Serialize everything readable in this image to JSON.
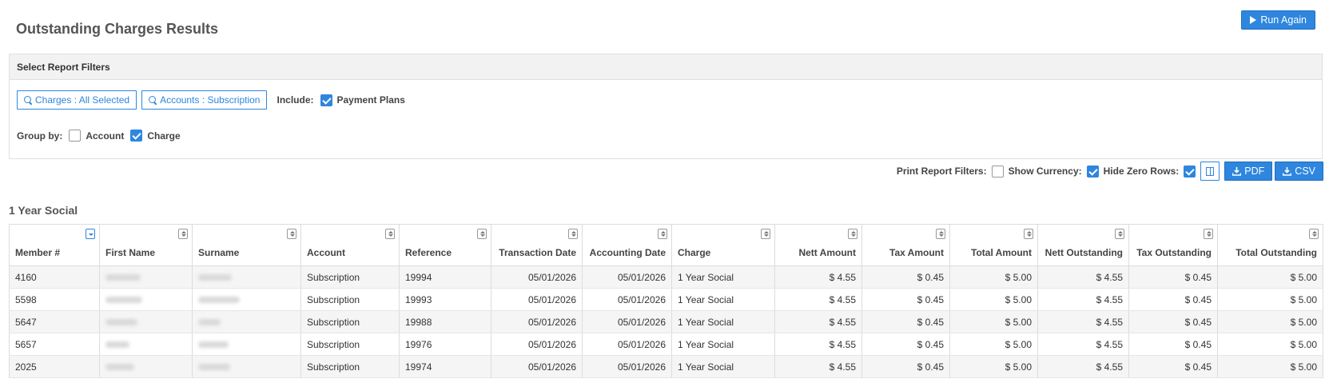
{
  "page": {
    "title": "Outstanding Charges Results",
    "run_again_label": "Run Again"
  },
  "filters": {
    "header": "Select Report Filters",
    "charges_button": "Charges : All Selected",
    "accounts_button": "Accounts : Subscription",
    "include_label": "Include:",
    "payment_plans_label": "Payment Plans",
    "payment_plans_checked": true,
    "group_by_label": "Group by:",
    "group_account_label": "Account",
    "group_account_checked": false,
    "group_charge_label": "Charge",
    "group_charge_checked": true
  },
  "toolbar": {
    "print_filters_label": "Print Report Filters:",
    "print_filters_checked": false,
    "show_currency_label": "Show Currency:",
    "show_currency_checked": true,
    "hide_zero_label": "Hide Zero Rows:",
    "hide_zero_checked": true,
    "columns_icon": "columns-icon",
    "pdf_label": "PDF",
    "csv_label": "CSV",
    "download_icon": "download-icon"
  },
  "section": {
    "title": "1 Year Social"
  },
  "table": {
    "columns": [
      "Member #",
      "First Name",
      "Surname",
      "Account",
      "Reference",
      "Transaction Date",
      "Accounting Date",
      "Charge",
      "Nett Amount",
      "Tax Amount",
      "Total Amount",
      "Nett Outstanding",
      "Tax Outstanding",
      "Total Outstanding"
    ],
    "rows": [
      {
        "member": "4160",
        "account": "Subscription",
        "reference": "19994",
        "transaction_date": "05/01/2026",
        "accounting_date": "05/01/2026",
        "charge": "1 Year Social",
        "nett_amount": "$ 4.55",
        "tax_amount": "$ 0.45",
        "total_amount": "$ 5.00",
        "nett_outstanding": "$ 4.55",
        "tax_outstanding": "$ 0.45",
        "total_outstanding": "$ 5.00"
      },
      {
        "member": "5598",
        "account": "Subscription",
        "reference": "19993",
        "transaction_date": "05/01/2026",
        "accounting_date": "05/01/2026",
        "charge": "1 Year Social",
        "nett_amount": "$ 4.55",
        "tax_amount": "$ 0.45",
        "total_amount": "$ 5.00",
        "nett_outstanding": "$ 4.55",
        "tax_outstanding": "$ 0.45",
        "total_outstanding": "$ 5.00"
      },
      {
        "member": "5647",
        "account": "Subscription",
        "reference": "19988",
        "transaction_date": "05/01/2026",
        "accounting_date": "05/01/2026",
        "charge": "1 Year Social",
        "nett_amount": "$ 4.55",
        "tax_amount": "$ 0.45",
        "total_amount": "$ 5.00",
        "nett_outstanding": "$ 4.55",
        "tax_outstanding": "$ 0.45",
        "total_outstanding": "$ 5.00"
      },
      {
        "member": "5657",
        "account": "Subscription",
        "reference": "19976",
        "transaction_date": "05/01/2026",
        "accounting_date": "05/01/2026",
        "charge": "1 Year Social",
        "nett_amount": "$ 4.55",
        "tax_amount": "$ 0.45",
        "total_amount": "$ 5.00",
        "nett_outstanding": "$ 4.55",
        "tax_outstanding": "$ 0.45",
        "total_outstanding": "$ 5.00"
      },
      {
        "member": "2025",
        "account": "Subscription",
        "reference": "19974",
        "transaction_date": "05/01/2026",
        "accounting_date": "05/01/2026",
        "charge": "1 Year Social",
        "nett_amount": "$ 4.55",
        "tax_amount": "$ 0.45",
        "total_amount": "$ 5.00",
        "nett_outstanding": "$ 4.55",
        "tax_outstanding": "$ 0.45",
        "total_outstanding": "$ 5.00"
      }
    ]
  },
  "colors": {
    "accent": "#2e86de",
    "header_bg": "#f2f2f2",
    "row_alt": "#f5f5f5"
  }
}
